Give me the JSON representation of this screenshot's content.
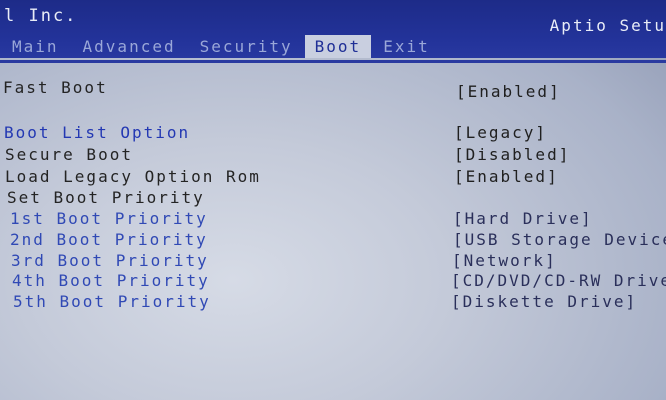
{
  "header": {
    "vendor": "l Inc.",
    "utility": "Aptio Setu",
    "tabs": [
      {
        "label": "Main"
      },
      {
        "label": "Advanced"
      },
      {
        "label": "Security"
      },
      {
        "label": "Boot"
      },
      {
        "label": "Exit"
      }
    ],
    "active_tab": "Boot"
  },
  "settings": [
    {
      "label": "Fast Boot",
      "value": "[Enabled]"
    },
    {
      "label": "Boot List Option",
      "value": "[Legacy]"
    },
    {
      "label": "Secure Boot",
      "value": "[Disabled]"
    },
    {
      "label": "Load Legacy Option Rom",
      "value": "[Enabled]"
    },
    {
      "label": "Set Boot Priority",
      "value": ""
    },
    {
      "label": "1st Boot Priority",
      "value": "[Hard Drive]"
    },
    {
      "label": "2nd Boot Priority",
      "value": "[USB Storage Device]"
    },
    {
      "label": "3rd Boot Priority",
      "value": "[Network]"
    },
    {
      "label": "4th Boot Priority",
      "value": "[CD/DVD/CD-RW Drive]"
    },
    {
      "label": "5th Boot Priority",
      "value": "[Diskette Drive]"
    }
  ]
}
